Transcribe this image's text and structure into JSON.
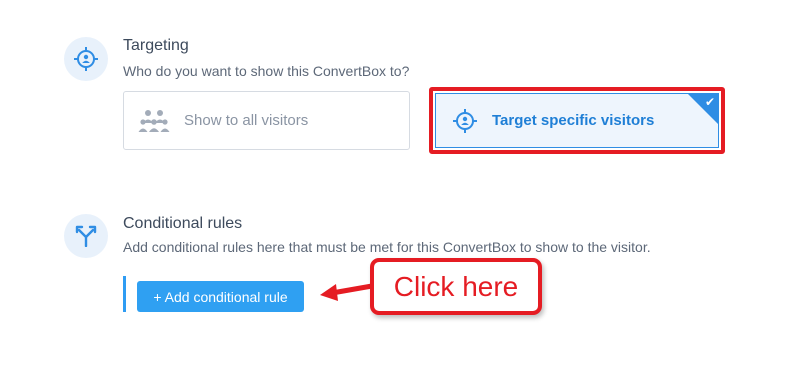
{
  "targeting": {
    "title": "Targeting",
    "subtitle": "Who do you want to show this ConvertBox to?",
    "icon": "target-person-icon",
    "options": [
      {
        "label": "Show to all visitors",
        "icon": "group-icon",
        "selected": false
      },
      {
        "label": "Target specific visitors",
        "icon": "target-person-icon",
        "selected": true
      }
    ]
  },
  "conditional": {
    "title": "Conditional rules",
    "subtitle": "Add conditional rules here that must be met for this ConvertBox to show to the visitor.",
    "icon": "fork-arrow-icon",
    "button_label": "+ Add conditional rule"
  },
  "callout": {
    "text": "Click here"
  },
  "colors": {
    "accent": "#2f9cf3",
    "highlight": "#e51c23",
    "selected_text": "#1f7fd6"
  }
}
